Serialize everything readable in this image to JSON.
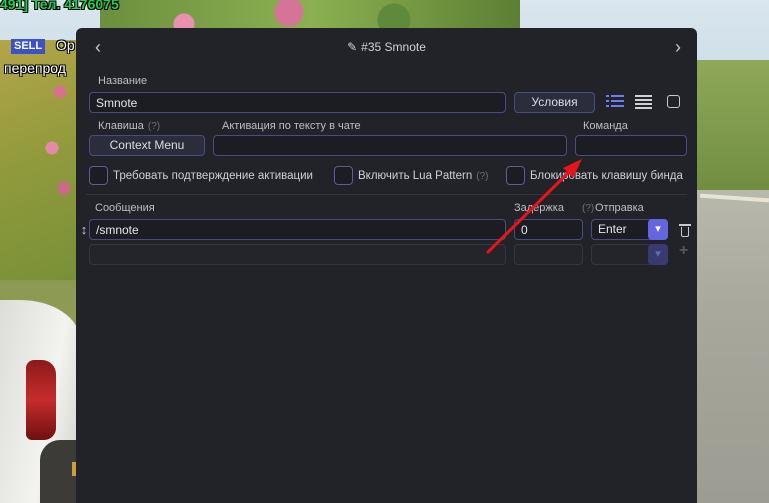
{
  "hud": {
    "top_text": "491] Тел. 4176075",
    "sell_badge": "SELL",
    "line1": "Op",
    "line2": "перепрод"
  },
  "dialog": {
    "title": "#35 Smnote",
    "name_label": "Название",
    "name_value": "Smnote",
    "conditions_button": "Условия",
    "key_label": "Клавиша",
    "key_hint": "(?)",
    "key_button": "Context Menu",
    "text_activation_label": "Активация по тексту в чате",
    "text_activation_value": "",
    "command_label": "Команда",
    "command_value": "",
    "checkbox_confirm": "Требовать подтверждение активации",
    "checkbox_lua": "Включить Lua Pattern",
    "checkbox_lua_hint": "(?)",
    "checkbox_block": "Блокировать клавишу бинда",
    "messages_label": "Сообщения",
    "delay_label": "Задержка",
    "delay_hint": "(?)",
    "send_label": "Отправка",
    "rows": [
      {
        "message": "/smnote",
        "delay": "0",
        "send": "Enter"
      },
      {
        "message": "",
        "delay": "",
        "send": ""
      }
    ]
  },
  "colors": {
    "accent": "#6466e0",
    "annotation_arrow": "#e8141c",
    "panel_bg": "#222329"
  }
}
